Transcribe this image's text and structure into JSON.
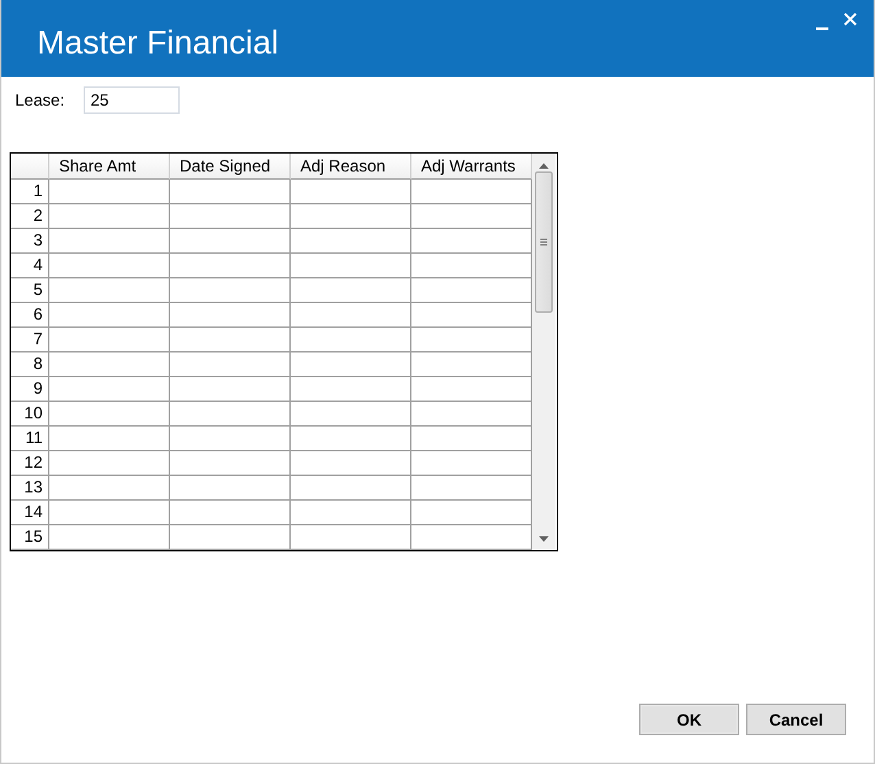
{
  "window": {
    "title": "Master Financial"
  },
  "lease": {
    "label": "Lease:",
    "value": "25"
  },
  "table": {
    "columns": [
      "Share Amt",
      "Date Signed",
      "Adj Reason",
      "Adj Warrants"
    ],
    "rows": [
      {
        "number": "1"
      },
      {
        "number": "2"
      },
      {
        "number": "3"
      },
      {
        "number": "4"
      },
      {
        "number": "5"
      },
      {
        "number": "6"
      },
      {
        "number": "7"
      },
      {
        "number": "8"
      },
      {
        "number": "9"
      },
      {
        "number": "10"
      },
      {
        "number": "11"
      },
      {
        "number": "12"
      },
      {
        "number": "13"
      },
      {
        "number": "14"
      },
      {
        "number": "15"
      }
    ]
  },
  "buttons": [
    {
      "label": "OK",
      "kind": "primary"
    },
    {
      "label": "Cancel",
      "kind": "secondary"
    }
  ]
}
